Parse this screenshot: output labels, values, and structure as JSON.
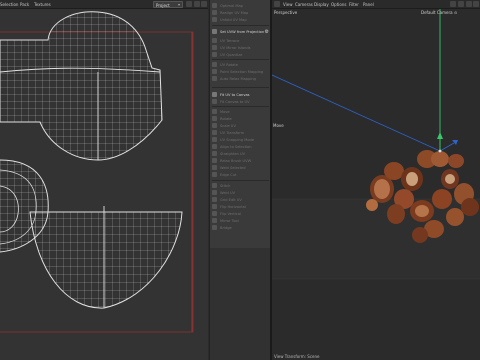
{
  "uv_editor": {
    "menu": [
      "Selection",
      "Pack",
      "Textures"
    ],
    "project_select": "Project",
    "project_select_caret": "▾"
  },
  "uv_tools": {
    "rows": [
      {
        "label": "Optimal Map",
        "active": false
      },
      {
        "label": "Realign UV Map",
        "active": false
      },
      {
        "label": "Unfold UV Map",
        "active": false
      },
      {
        "label": "Set UVW from Projection",
        "active": true,
        "gear": "⚙"
      },
      {
        "label": "UV Terrace",
        "active": false
      },
      {
        "label": "UV Mirror Islands",
        "active": false
      },
      {
        "label": "UV Quantize",
        "active": false
      },
      {
        "label": "UV Rotate",
        "active": false
      },
      {
        "label": "Point Selection Mapping",
        "active": false
      },
      {
        "label": "Auto Relax Mapping",
        "active": false
      },
      {
        "label": "Fit UV to Canvas",
        "active": true
      },
      {
        "label": "Fit Canvas to UV",
        "active": false
      },
      {
        "label": "Move",
        "active": false
      },
      {
        "label": "Rotate",
        "active": false
      },
      {
        "label": "Scale UV",
        "active": false
      },
      {
        "label": "UV Transform",
        "active": false
      },
      {
        "label": "UV Snapping Mode",
        "active": false
      },
      {
        "label": "Align to Selection",
        "active": false
      },
      {
        "label": "Straighten UV",
        "active": false
      },
      {
        "label": "Relax Brush UVW",
        "active": false
      },
      {
        "label": "Weld Selected",
        "active": false
      },
      {
        "label": "Edge Cut",
        "active": false
      },
      {
        "label": "Stitch",
        "active": false
      },
      {
        "label": "Weld UV",
        "active": false
      },
      {
        "label": "Grid Edit UV",
        "active": false
      },
      {
        "label": "Flip Horizontal",
        "active": false
      },
      {
        "label": "Flip Vertical",
        "active": false
      },
      {
        "label": "Mirror Tool",
        "active": false
      },
      {
        "label": "Bridge",
        "active": false
      }
    ]
  },
  "viewport": {
    "menu": [
      "View",
      "Cameras",
      "Display",
      "Options",
      "Filter",
      "Panel"
    ],
    "label": "Perspective",
    "camera": "Default Camera",
    "camera_icon": "⊙",
    "tool": "Move",
    "footer": "View Transform: Scene"
  },
  "colors": {
    "uv_lines": "#d9d9d9",
    "uv_border": "#b33434",
    "axis_y": "#35c96a",
    "axis_x": "#2e63c9"
  }
}
